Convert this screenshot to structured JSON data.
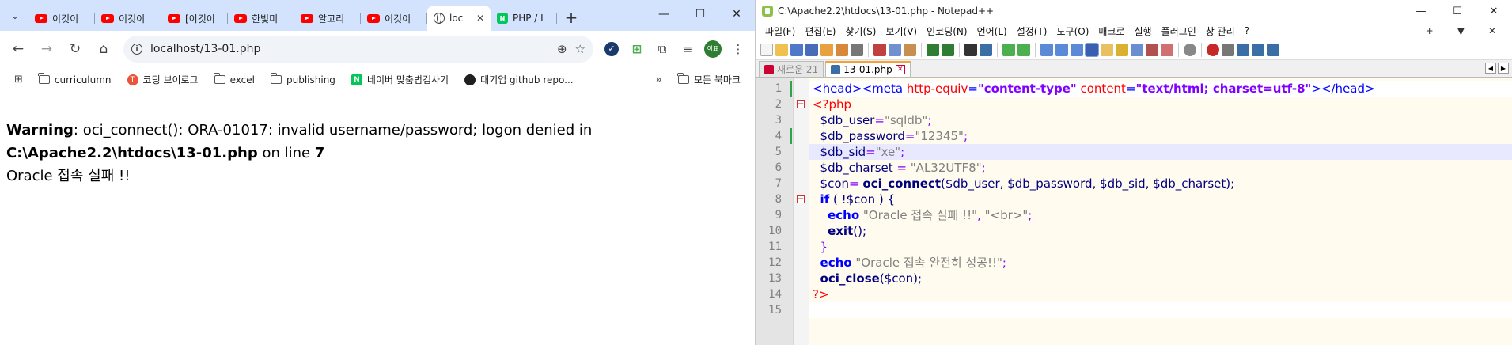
{
  "chrome": {
    "tabs_menu_icon": "chevron-down",
    "tabs": [
      {
        "label": "이것이",
        "icon": "youtube",
        "active": false
      },
      {
        "label": "이것이",
        "icon": "youtube",
        "active": false
      },
      {
        "label": "[이것이",
        "icon": "youtube",
        "active": false
      },
      {
        "label": "한빛미",
        "icon": "youtube",
        "active": false
      },
      {
        "label": "알고리",
        "icon": "youtube",
        "active": false
      },
      {
        "label": "이것이",
        "icon": "youtube",
        "active": false
      },
      {
        "label": "loc",
        "icon": "globe",
        "active": true
      },
      {
        "label": "PHP / I",
        "icon": "naver",
        "active": false
      }
    ],
    "new_tab_label": "+",
    "window_controls": {
      "minimize": "—",
      "maximize": "☐",
      "close": "✕"
    },
    "url": "localhost/13-01.php",
    "profile_initials": "이표",
    "bookmarks": [
      {
        "label": "curriculumn",
        "icon": "folder"
      },
      {
        "label": "코딩 브이로그",
        "icon": "red-circle"
      },
      {
        "label": "excel",
        "icon": "folder"
      },
      {
        "label": "publishing",
        "icon": "folder"
      },
      {
        "label": "네이버 맞춤법검사기",
        "icon": "naver"
      },
      {
        "label": "대기업 github repo...",
        "icon": "github"
      }
    ],
    "bookmarks_more": "»",
    "all_bookmarks_label": "모든 북마크",
    "page": {
      "warning_label": "Warning",
      "warning_text": ": oci_connect(): ORA-01017: invalid username/password; logon denied in",
      "file_path": "C:\\Apache2.2\\htdocs\\13-01.php",
      "on_line_text": " on line ",
      "line_number": "7",
      "fail_message": "Oracle 접속 실패 !!"
    }
  },
  "notepad": {
    "title": "C:\\Apache2.2\\htdocs\\13-01.php - Notepad++",
    "window_controls": {
      "minimize": "—",
      "maximize": "☐",
      "close": "✕"
    },
    "menu": [
      "파일(F)",
      "편집(E)",
      "찾기(S)",
      "보기(V)",
      "인코딩(N)",
      "언어(L)",
      "설정(T)",
      "도구(O)",
      "매크로",
      "실행",
      "플러그인",
      "창 관리",
      "?"
    ],
    "menu_right": [
      "+",
      "▼",
      "✕"
    ],
    "tabs": [
      {
        "label": "새로운 21",
        "active": false
      },
      {
        "label": "13-01.php",
        "active": true
      }
    ],
    "line_numbers": [
      "1",
      "2",
      "3",
      "4",
      "5",
      "6",
      "7",
      "8",
      "9",
      "10",
      "11",
      "12",
      "13",
      "14",
      "15"
    ],
    "code": {
      "l1": {
        "open_head": "<head>",
        "meta_open": "<meta",
        "attr1": " http-equiv",
        "eq1": "=",
        "val1": "\"content-type\"",
        "attr2": " content",
        "eq2": "=",
        "val2": "\"text/html; charset=utf-8\"",
        "gt": ">",
        "close_head": "</head>"
      },
      "l2": {
        "php_open": "<?php"
      },
      "l3": {
        "var": "$db_user",
        "op": "=",
        "str": "\"sqldb\"",
        "semi": ";"
      },
      "l4": {
        "var": "$db_password",
        "op": "=",
        "str": "\"12345\"",
        "semi": ";"
      },
      "l5": {
        "var": "$db_sid",
        "op": "=",
        "str": "\"xe\"",
        "semi": ";"
      },
      "l6": {
        "var": "$db_charset",
        "op": " = ",
        "str": "\"AL32UTF8\"",
        "semi": ";"
      },
      "l7": {
        "var": "$con",
        "op": "= ",
        "fn": "oci_connect",
        "args": "($db_user, $db_password, $db_sid, $db_charset);"
      },
      "l8": {
        "kw": "if",
        "rest": " ( !$con ) {"
      },
      "l9": {
        "kw": "echo",
        "str": " \"Oracle 접속 실패 !!\"",
        "op": ", ",
        "str2": "\"<br>\"",
        "semi": ";"
      },
      "l10": {
        "fn": "exit",
        "rest": "();"
      },
      "l11": {
        "rest": "}"
      },
      "l12": {
        "kw": "echo",
        "str": " \"Oracle 접속 완전히 성공!!\"",
        "semi": ";"
      },
      "l13": {
        "fn": "oci_close",
        "rest": "($con);"
      },
      "l14": {
        "php_close": "?>"
      },
      "l15": {}
    }
  }
}
